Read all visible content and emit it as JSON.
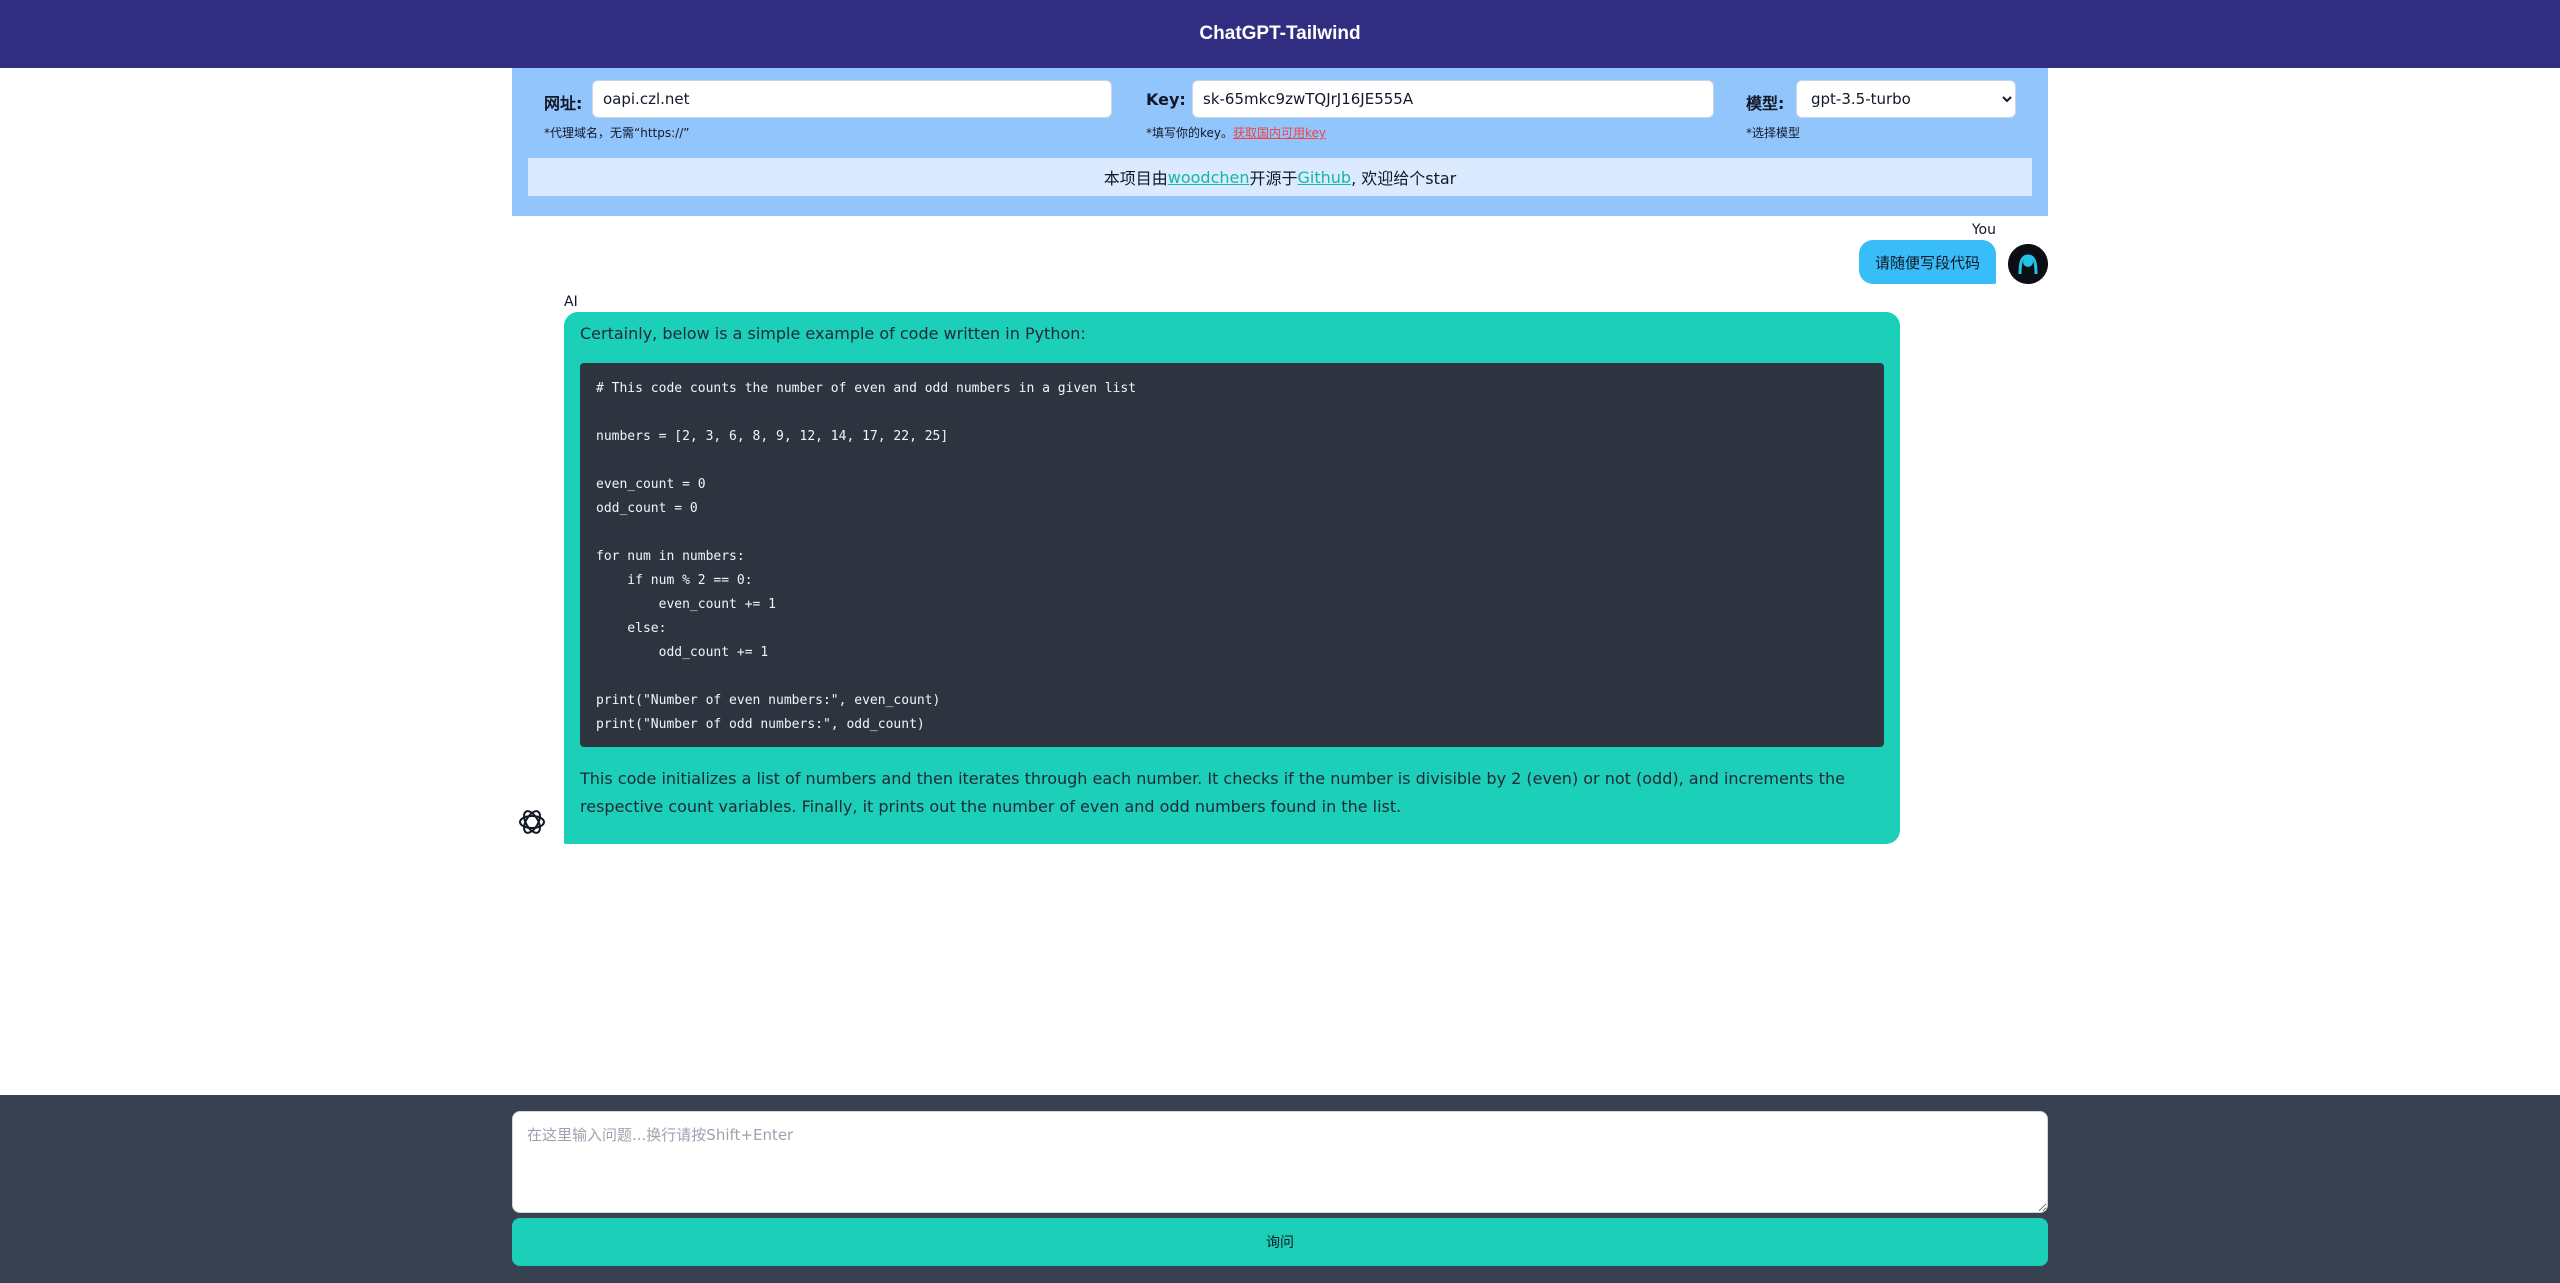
{
  "header": {
    "title": "ChatGPT-Tailwind"
  },
  "settings": {
    "url": {
      "label": "网址:",
      "value": "oapi.czl.net",
      "hint": "*代理域名，无需“https://”"
    },
    "key": {
      "label": "Key:",
      "value": "sk-65mkc9zwTQJrJ16JE555A",
      "hint_prefix": "*填写你的key。",
      "hint_link": "获取国内可用key"
    },
    "model": {
      "label": "模型:",
      "selected": "gpt-3.5-turbo",
      "hint": "*选择模型"
    }
  },
  "notice": {
    "prefix": "本项目由",
    "author": "woodchen",
    "mid": "开源于",
    "repo": "Github",
    "suffix": ", 欢迎给个star"
  },
  "chat": {
    "you_label": "You",
    "user_message": "请随便写段代码",
    "ai_label": "AI",
    "ai_intro": "Certainly, below is a simple example of code written in Python:",
    "code": "# This code counts the number of even and odd numbers in a given list\n\nnumbers = [2, 3, 6, 8, 9, 12, 14, 17, 22, 25]\n\neven_count = 0\nodd_count = 0\n\nfor num in numbers:\n    if num % 2 == 0:\n        even_count += 1\n    else:\n        odd_count += 1\n\nprint(\"Number of even numbers:\", even_count)\nprint(\"Number of odd numbers:\", odd_count)",
    "ai_outro": "This code initializes a list of numbers and then iterates through each number. It checks if the number is divisible by 2 (even) or not (odd), and increments the respective count variables. Finally, it prints out the number of even and odd numbers found in the list."
  },
  "composer": {
    "placeholder": "在这里输入问题...换行请按Shift+Enter",
    "button_label": "询问"
  },
  "icons": {
    "user_avatar": "user-avatar-icon",
    "ai_avatar": "openai-logo-icon"
  },
  "colors": {
    "header": "#312e81",
    "panel": "#93c5fd",
    "accent": "#1ccfb8",
    "user_bubble": "#38bdf8",
    "footer": "#374151"
  }
}
